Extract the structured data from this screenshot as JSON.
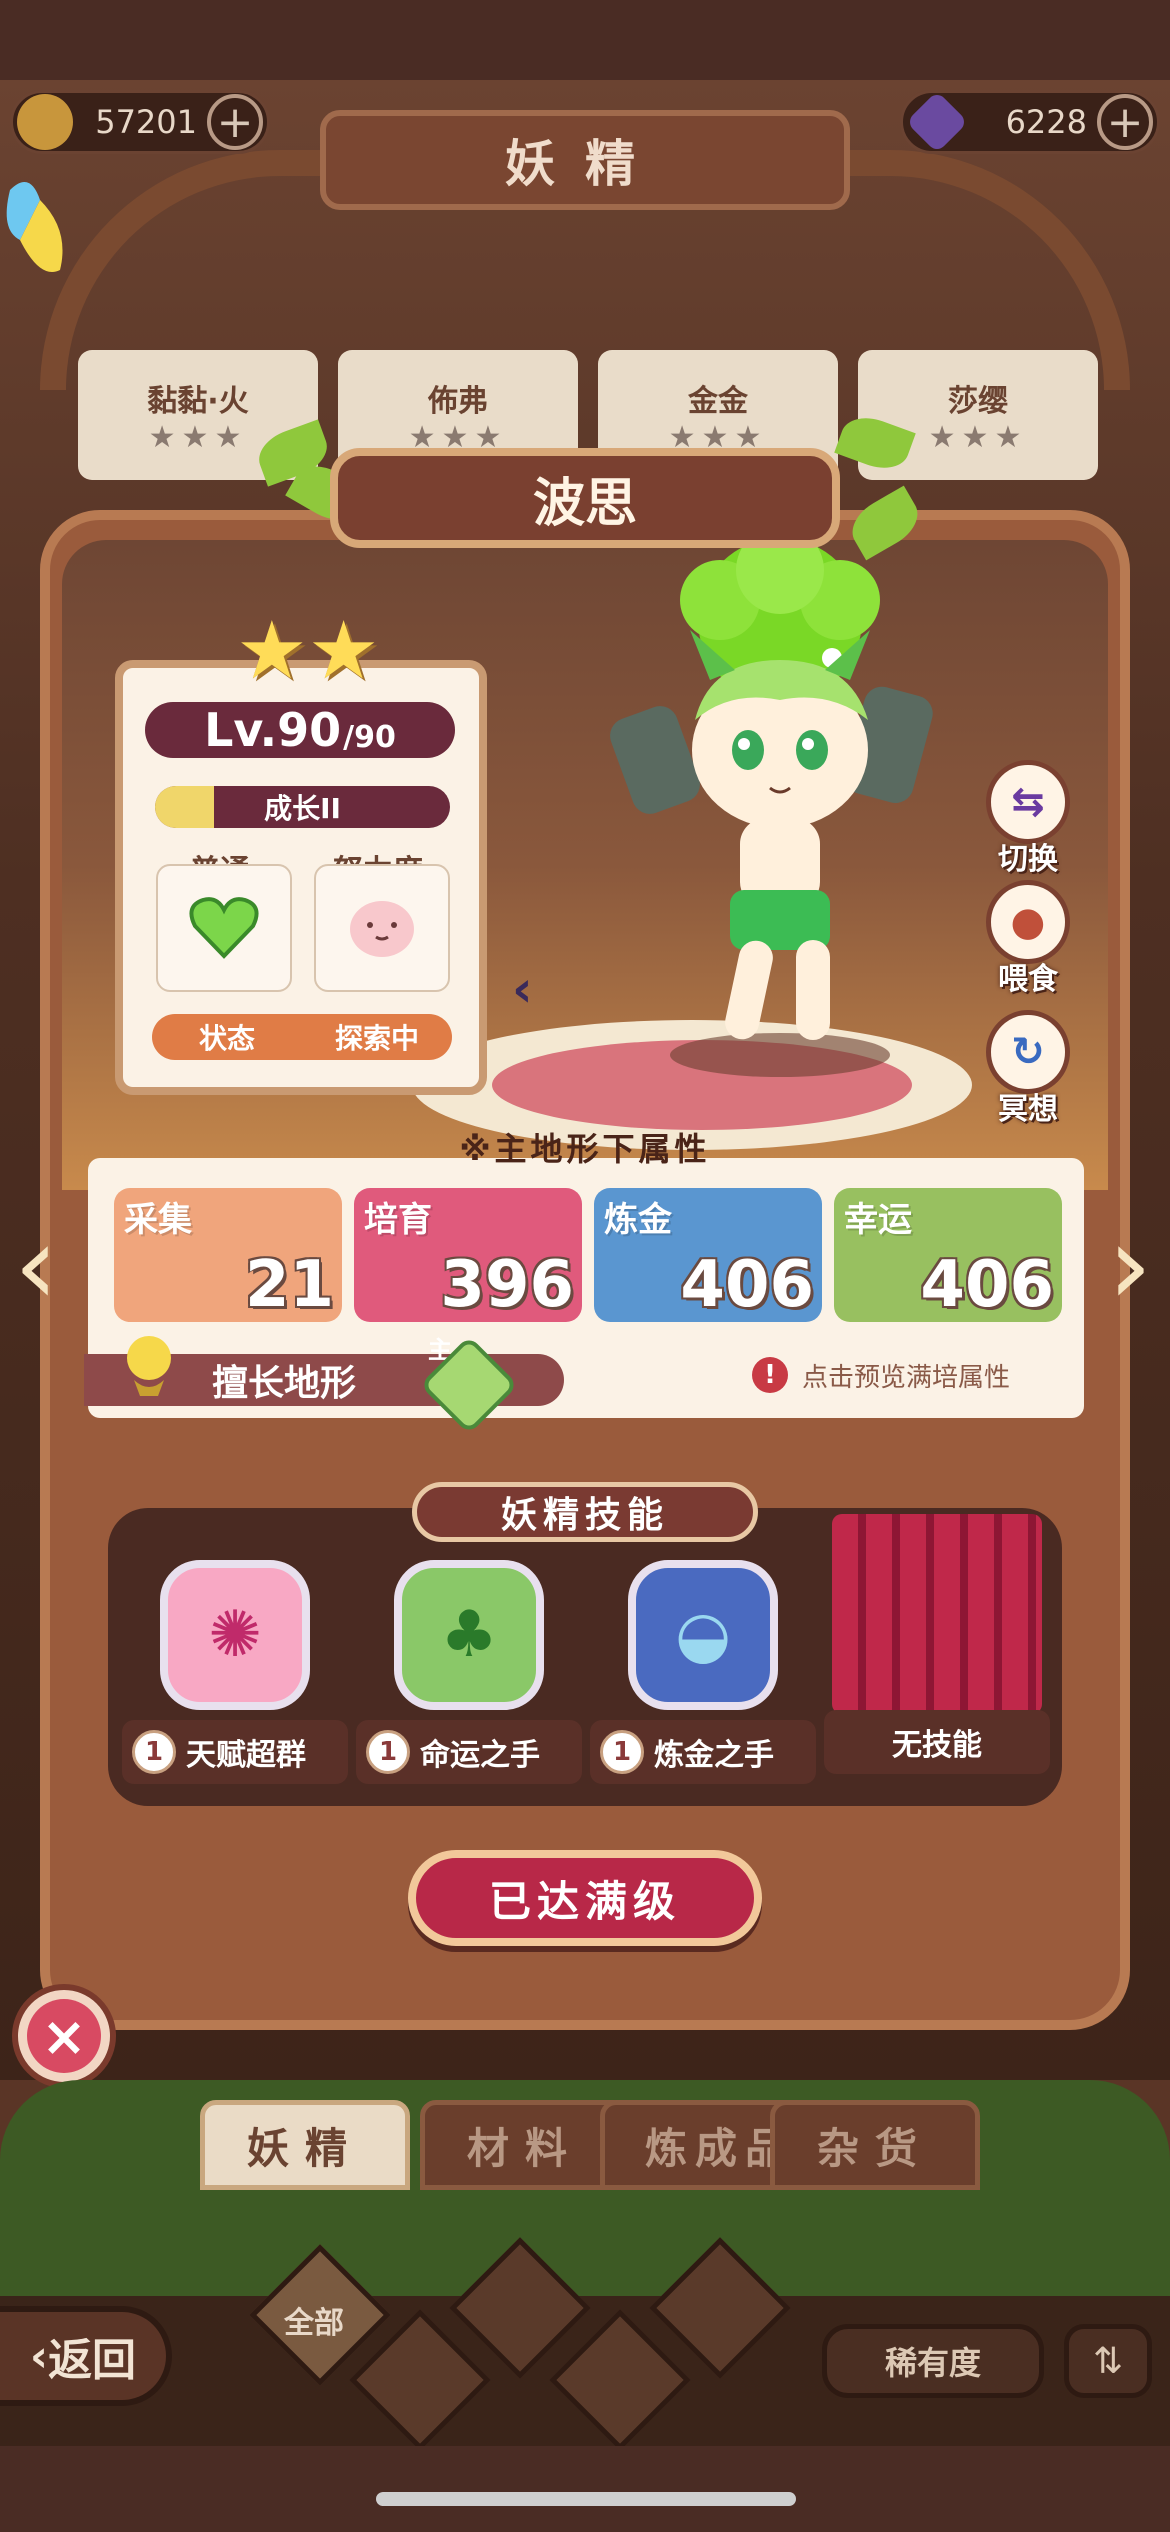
{
  "header": {
    "title": "妖精",
    "gold": "57201",
    "gems": "6228"
  },
  "background_fairies": [
    {
      "name": "黏黏·火"
    },
    {
      "name": "佈弗"
    },
    {
      "name": "金金"
    },
    {
      "name": "莎缨"
    }
  ],
  "fairy": {
    "name": "波思",
    "level": "Lv.90",
    "level_max": "/90",
    "stars": 2,
    "growth_label": "成长II",
    "growth_progress": 0.2,
    "mood_label": "普通",
    "effort_label": "努力度",
    "state_label": "状态",
    "state_value": "探索中"
  },
  "actions": {
    "switch": "切换",
    "feed": "喂食",
    "meditate": "冥想"
  },
  "attributes": {
    "note": "※主地形下属性",
    "items": [
      {
        "name": "采集",
        "value": "21",
        "color": "#f0a57c"
      },
      {
        "name": "培育",
        "value": "396",
        "color": "#e05a7c"
      },
      {
        "name": "炼金",
        "value": "406",
        "color": "#5a96d0"
      },
      {
        "name": "幸运",
        "value": "406",
        "color": "#98c060"
      }
    ],
    "terrain_label": "擅长地形",
    "terrain_main": "主",
    "preview_hint": "点击预览满培属性"
  },
  "skills": {
    "title": "妖精技能",
    "items": [
      {
        "level": "1",
        "name": "天赋超群",
        "icon": "octopus-icon"
      },
      {
        "level": "1",
        "name": "命运之手",
        "icon": "clover-icon"
      },
      {
        "level": "1",
        "name": "炼金之手",
        "icon": "cauldron-icon"
      }
    ],
    "empty_label": "无技能"
  },
  "max_button": "已达满级",
  "bottom_tabs": [
    "妖精",
    "材料",
    "炼成品",
    "杂货"
  ],
  "filters": {
    "all": "全部"
  },
  "back_label": "返回",
  "sort_label": "稀有度",
  "colors": {
    "frame": "#9a5b3c",
    "accent": "#b82848",
    "panel": "#fbf2e6"
  }
}
